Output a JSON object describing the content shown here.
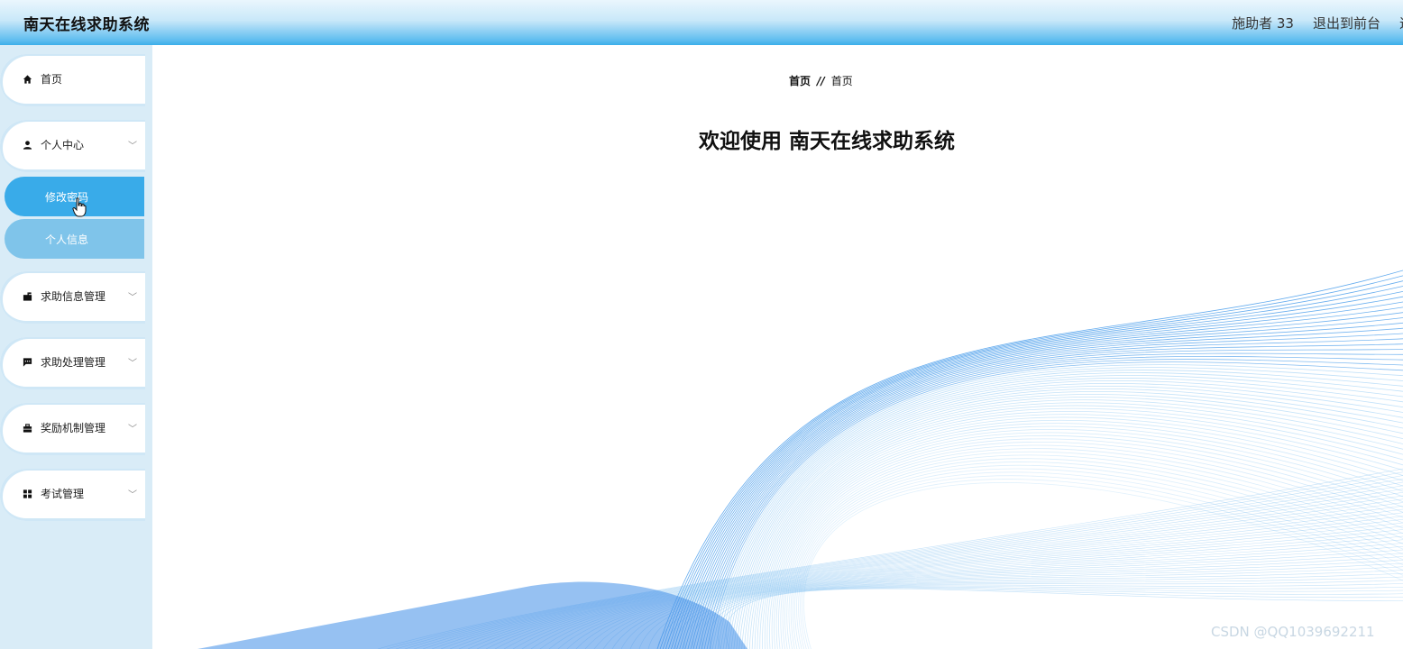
{
  "header": {
    "app_title": "南天在线求助系统",
    "user_label": "施助者 33",
    "exit_label": "退出到前台",
    "cut_label": "退"
  },
  "sidebar": {
    "items": [
      {
        "label": "首页",
        "icon": "home-icon"
      },
      {
        "label": "个人中心",
        "icon": "user-icon",
        "expanded": true,
        "children": [
          {
            "label": "修改密码",
            "active": true
          },
          {
            "label": "个人信息",
            "active": false
          }
        ]
      },
      {
        "label": "求助信息管理",
        "icon": "mailbox-icon"
      },
      {
        "label": "求助处理管理",
        "icon": "message-icon"
      },
      {
        "label": "奖励机制管理",
        "icon": "briefcase-icon"
      },
      {
        "label": "考试管理",
        "icon": "grid-icon"
      }
    ]
  },
  "main": {
    "breadcrumb": {
      "root": "首页",
      "separator": "//",
      "current": "首页"
    },
    "welcome": "欢迎使用 南天在线求助系统"
  },
  "watermark": "CSDN @QQ1039692211",
  "colors": {
    "accent": "#39abe9",
    "sub_item": "#7fc4ea",
    "sidebar_bg": "#d9ecf7",
    "wave": "#2f8fe8"
  }
}
